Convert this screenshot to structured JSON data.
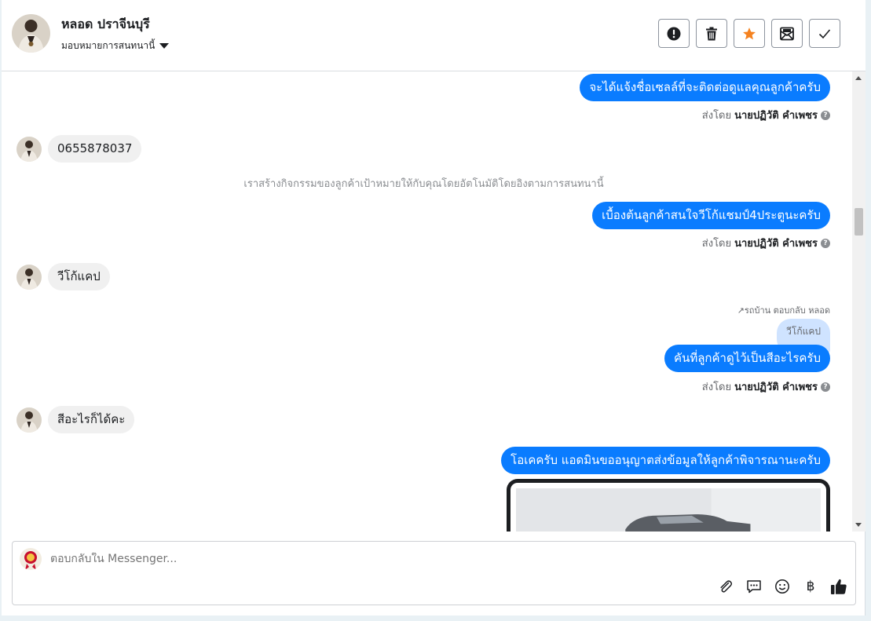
{
  "header": {
    "contact_name": "หลอด ปราจีนบุรี",
    "assign_label": "มอบหมายการสนทนานี้",
    "actions": [
      "mark-spam",
      "delete",
      "star",
      "mark-unread",
      "done"
    ]
  },
  "thread": {
    "msg1": "จะได้แจ้งชื่อเซลล์ที่จะติดต่อดูแลคุณลูกค้าครับ",
    "sent_by_prefix": "ส่งโดย",
    "agent_name": "นายปฏิวัติ คำเพชร",
    "in1": "0655878037",
    "system_note": "เราสร้างกิจกรรมของลูกค้าเป้าหมายให้กับคุณโดยอัตโนมัติโดยอิงตามการสนทนานี้",
    "msg2": "เบื้องต้นลูกค้าสนใจวีโก้แชมป์4ประตูนะครับ",
    "in2": "วีโก้แคป",
    "reply_hint": "รถบ้าน ตอบกลับ หลอด",
    "quoted": "วีโก้แคป",
    "msg3": "คันที่ลูกค้าดูไว้เป็นสีอะไรครับ",
    "in3": "สีอะไรก็ได้คะ",
    "msg4": "โอเคครับ แอดมินขออนุญาตส่งข้อมูลให้ลูกค้าพิจารณานะครับ"
  },
  "composer": {
    "placeholder": "ตอบกลับใน Messenger...",
    "tools": [
      "paperclip-icon",
      "speech-bubble-icon",
      "smiley-icon",
      "baht-icon",
      "thumbs-up-icon"
    ],
    "baht_symbol": "฿"
  },
  "colors": {
    "outgoing": "#0a7cff",
    "incoming": "#f0f0f0",
    "star": "#f5821f"
  }
}
